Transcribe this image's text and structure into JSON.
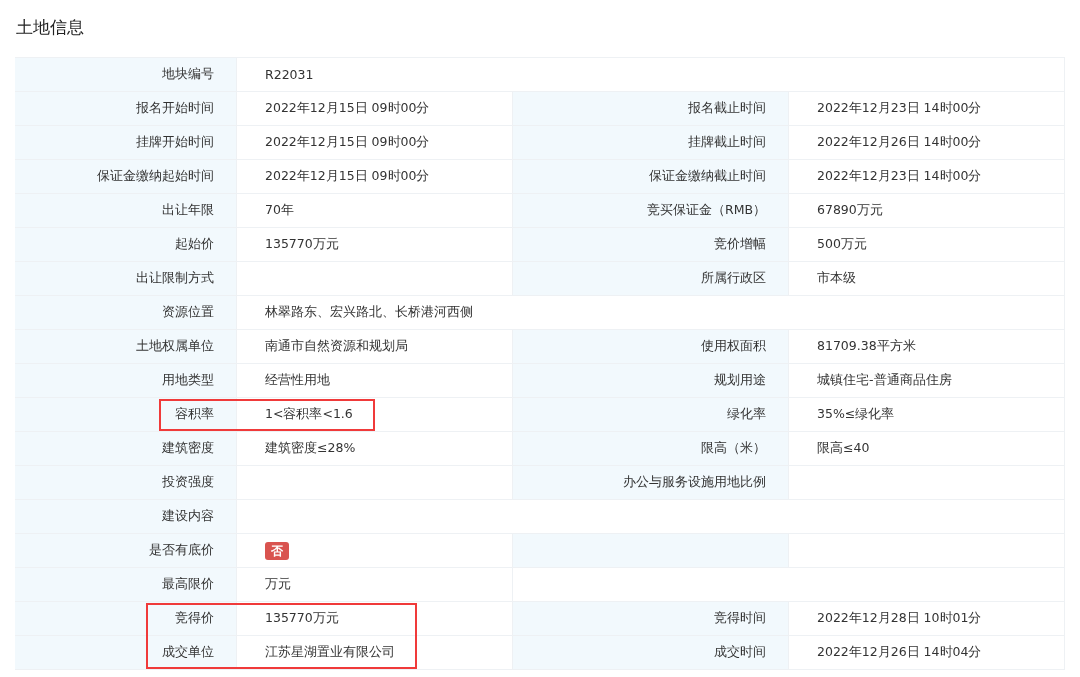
{
  "title": "土地信息",
  "rows": [
    {
      "kind": "full",
      "label": "地块编号",
      "value": "R22031"
    },
    {
      "kind": "pair",
      "label": "报名开始时间",
      "value": "2022年12月15日 09时00分",
      "label2": "报名截止时间",
      "value2": "2022年12月23日 14时00分"
    },
    {
      "kind": "pair",
      "label": "挂牌开始时间",
      "value": "2022年12月15日 09时00分",
      "label2": "挂牌截止时间",
      "value2": "2022年12月26日 14时00分"
    },
    {
      "kind": "pair",
      "label": "保证金缴纳起始时间",
      "value": "2022年12月15日 09时00分",
      "label2": "保证金缴纳截止时间",
      "value2": "2022年12月23日 14时00分"
    },
    {
      "kind": "pair",
      "label": "出让年限",
      "value": "70年",
      "label2": "竞买保证金（RMB）",
      "value2": "67890万元"
    },
    {
      "kind": "pair",
      "label": "起始价",
      "value": "135770万元",
      "label2": "竞价增幅",
      "value2": "500万元"
    },
    {
      "kind": "pair",
      "label": "出让限制方式",
      "label2": "所属行政区",
      "value2": "市本级"
    },
    {
      "kind": "full",
      "label": "资源位置",
      "value": "林翠路东、宏兴路北、长桥港河西侧"
    },
    {
      "kind": "pair",
      "label": "土地权属单位",
      "value": "南通市自然资源和规划局",
      "label2": "使用权面积",
      "value2": "81709.38平方米"
    },
    {
      "kind": "pair",
      "label": "用地类型",
      "value": "经营性用地",
      "label2": "规划用途",
      "value2": "城镇住宅-普通商品住房"
    },
    {
      "kind": "pair",
      "label": "容积率",
      "value": "1<容积率<1.6",
      "label2": "绿化率",
      "value2": "35%≤绿化率",
      "highlighted": true
    },
    {
      "kind": "pair",
      "label": "建筑密度",
      "value": "建筑密度≤28%",
      "label2": "限高（米）",
      "value2": "限高≤40"
    },
    {
      "kind": "pair",
      "label": "投资强度",
      "label2": "办公与服务设施用地比例"
    },
    {
      "kind": "full",
      "label": "建设内容"
    },
    {
      "kind": "pair",
      "label": "是否有底价",
      "badge": "否"
    },
    {
      "kind": "half",
      "label": "最高限价",
      "value": "万元"
    },
    {
      "kind": "pair",
      "label": "竞得价",
      "value": "135770万元",
      "label2": "竞得时间",
      "value2": "2022年12月28日 10时01分",
      "highlighted": true
    },
    {
      "kind": "pair",
      "label": "成交单位",
      "value": "江苏星湖置业有限公司",
      "label2": "成交时间",
      "value2": "2022年12月26日 14时04分",
      "highlighted": true
    }
  ]
}
